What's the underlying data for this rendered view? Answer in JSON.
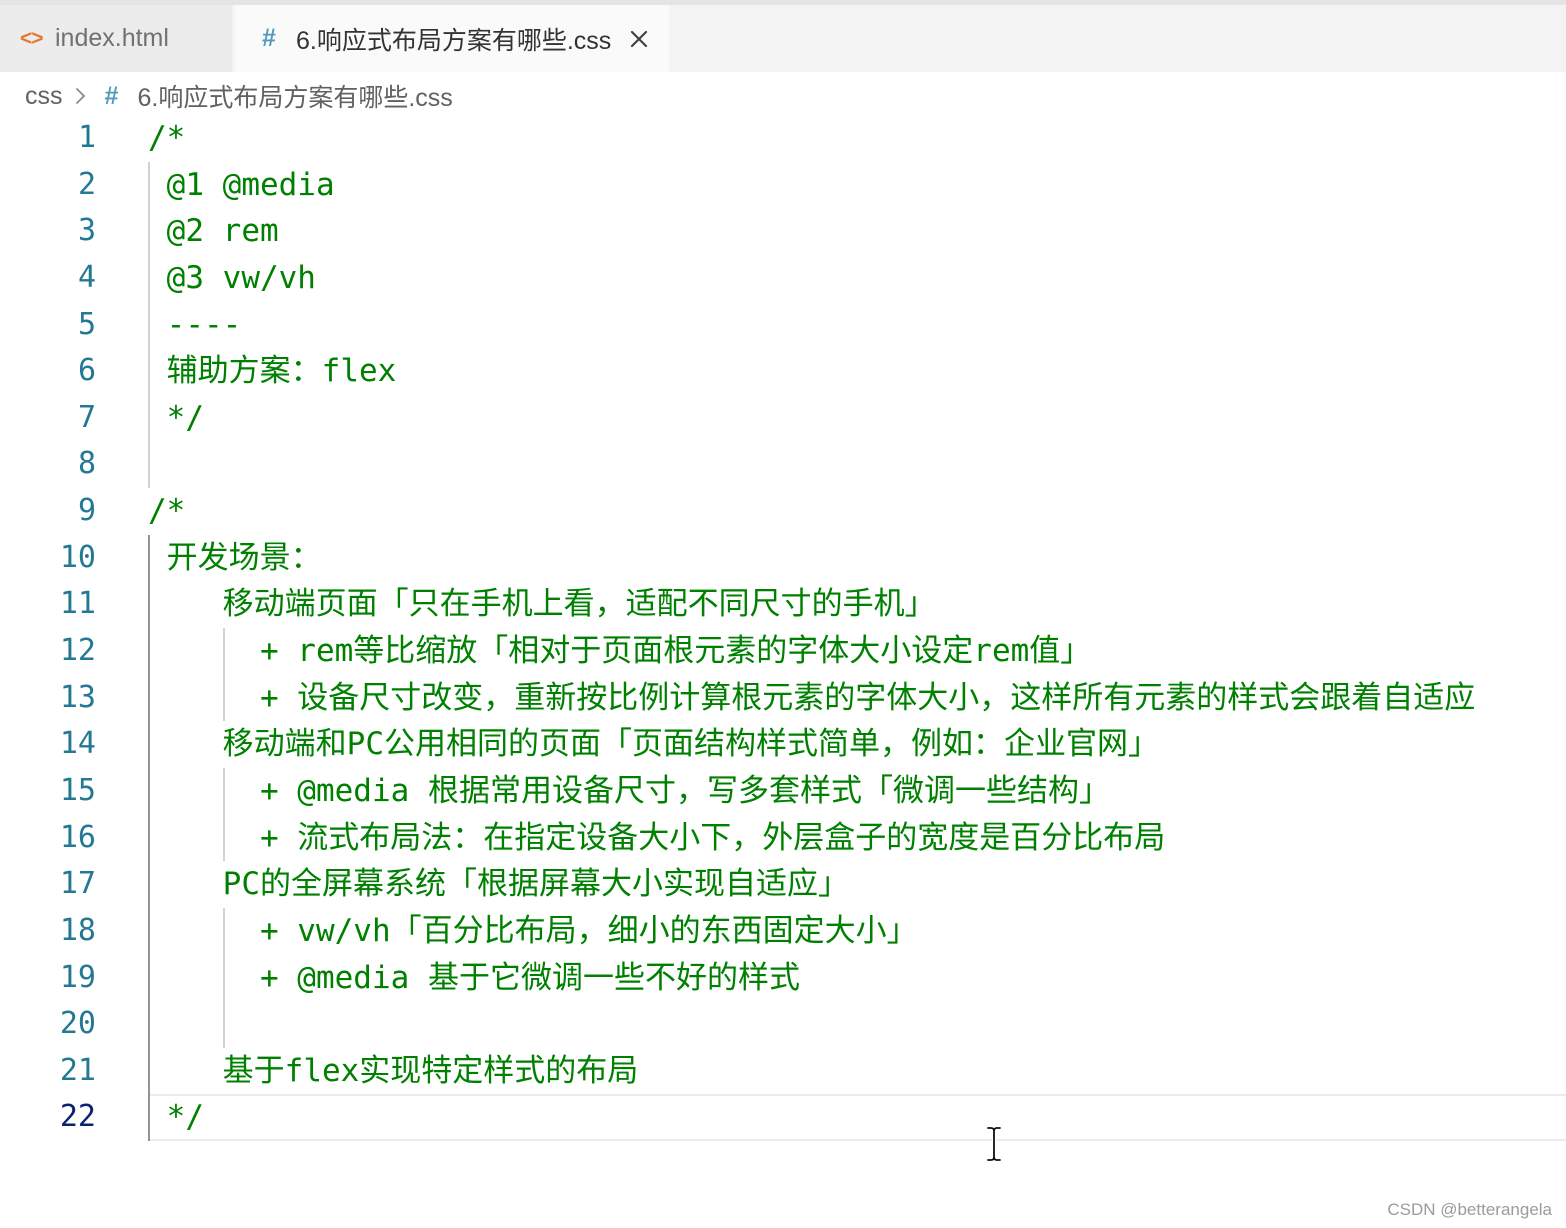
{
  "colors": {
    "comment": "#008000",
    "line_number": "#237893",
    "active_line_number": "#0b216f",
    "html_icon": "#e37933",
    "css_icon": "#519aba"
  },
  "tabs": [
    {
      "icon": "html-file-icon",
      "icon_glyph": "<>",
      "label": "index.html",
      "active": false
    },
    {
      "icon": "css-file-icon",
      "icon_glyph": "#",
      "label": "6.响应式布局方案有哪些.css",
      "active": true,
      "close_icon": "close-icon"
    }
  ],
  "breadcrumb": {
    "folder": "css",
    "separator_icon": "chevron-right-icon",
    "file_icon": "css-file-icon",
    "file_icon_glyph": "#",
    "file": "6.响应式布局方案有哪些.css"
  },
  "editor": {
    "active_line": 22,
    "lines": [
      {
        "number": "1",
        "text": "/*"
      },
      {
        "number": "2",
        "text": " @1 @media"
      },
      {
        "number": "3",
        "text": " @2 rem"
      },
      {
        "number": "4",
        "text": " @3 vw/vh"
      },
      {
        "number": "5",
        "text": " ----"
      },
      {
        "number": "6",
        "text": " 辅助方案：flex"
      },
      {
        "number": "7",
        "text": " */"
      },
      {
        "number": "8",
        "text": ""
      },
      {
        "number": "9",
        "text": "/*"
      },
      {
        "number": "10",
        "text": " 开发场景："
      },
      {
        "number": "11",
        "text": "    移动端页面「只在手机上看，适配不同尺寸的手机」"
      },
      {
        "number": "12",
        "text": "      + rem等比缩放「相对于页面根元素的字体大小设定rem值」"
      },
      {
        "number": "13",
        "text": "      + 设备尺寸改变，重新按比例计算根元素的字体大小，这样所有元素的样式会跟着自适应"
      },
      {
        "number": "14",
        "text": "    移动端和PC公用相同的页面「页面结构样式简单，例如：企业官网」"
      },
      {
        "number": "15",
        "text": "      + @media 根据常用设备尺寸，写多套样式「微调一些结构」"
      },
      {
        "number": "16",
        "text": "      + 流式布局法：在指定设备大小下，外层盒子的宽度是百分比布局"
      },
      {
        "number": "17",
        "text": "    PC的全屏幕系统「根据屏幕大小实现自适应」"
      },
      {
        "number": "18",
        "text": "      + vw/vh「百分比布局，细小的东西固定大小」"
      },
      {
        "number": "19",
        "text": "      + @media 基于它微调一些不好的样式"
      },
      {
        "number": "20",
        "text": ""
      },
      {
        "number": "21",
        "text": "    基于flex实现特定样式的布局"
      },
      {
        "number": "22",
        "text": " */"
      }
    ]
  },
  "watermark": "CSDN @betterangela"
}
